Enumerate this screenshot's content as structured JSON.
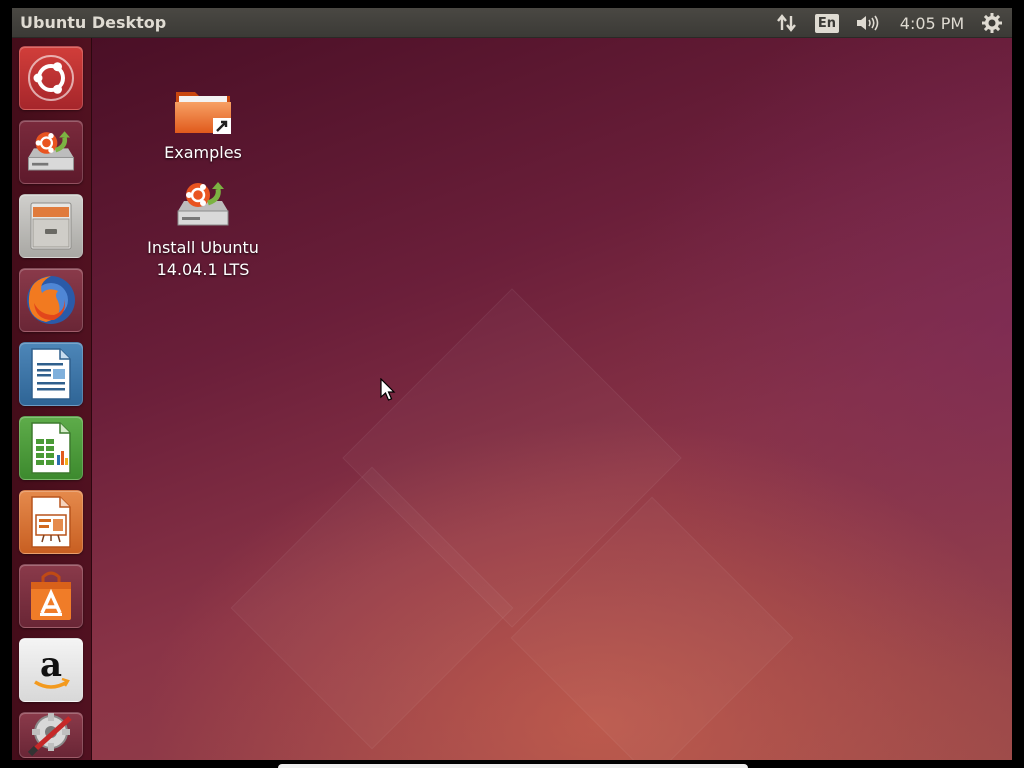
{
  "top_panel": {
    "title": "Ubuntu Desktop",
    "keyboard_layout": "En",
    "clock": "4:05 PM",
    "icons": {
      "network": "network-updown-icon",
      "sound": "volume-icon",
      "session": "gear-icon"
    }
  },
  "launcher": {
    "items": [
      {
        "name": "dash-home",
        "icon": "ubuntu-logo-icon"
      },
      {
        "name": "install-ubuntu",
        "icon": "installer-icon"
      },
      {
        "name": "files",
        "icon": "file-cabinet-icon"
      },
      {
        "name": "firefox",
        "icon": "firefox-icon"
      },
      {
        "name": "libreoffice-writer",
        "icon": "writer-document-icon"
      },
      {
        "name": "libreoffice-calc",
        "icon": "calc-spreadsheet-icon"
      },
      {
        "name": "libreoffice-impress",
        "icon": "impress-presentation-icon"
      },
      {
        "name": "ubuntu-software-center",
        "icon": "shopping-bag-icon"
      },
      {
        "name": "amazon",
        "icon": "amazon-icon"
      },
      {
        "name": "system-settings",
        "icon": "settings-tools-icon"
      }
    ]
  },
  "desktop": {
    "icons": [
      {
        "label": "Examples",
        "icon": "folder-link-icon"
      },
      {
        "label_line1": "Install Ubuntu",
        "label_line2": "14.04.1 LTS",
        "icon": "installer-icon"
      }
    ]
  },
  "colors": {
    "panel": "#3b3a36",
    "launcher": "#5a1426",
    "wallpaper_dark": "#4a0f26",
    "wallpaper_light": "#9c4a4a",
    "orange": "#e95420"
  }
}
